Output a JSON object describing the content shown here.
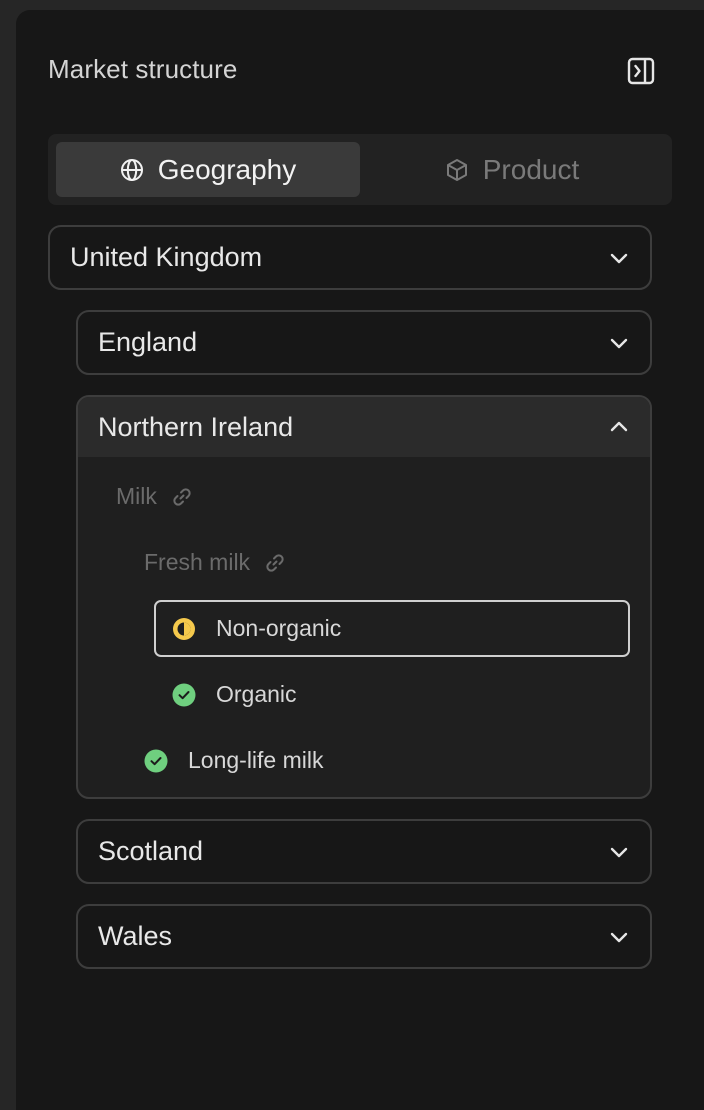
{
  "panel": {
    "title": "Market structure",
    "collapse_icon": "sidebar-collapse-icon"
  },
  "tabs": [
    {
      "label": "Geography",
      "icon": "globe-icon",
      "active": true
    },
    {
      "label": "Product",
      "icon": "cube-icon",
      "active": false
    }
  ],
  "tree": {
    "root": {
      "label": "United Kingdom",
      "expanded": false
    },
    "regions": [
      {
        "label": "England",
        "expanded": false
      },
      {
        "label": "Northern Ireland",
        "expanded": true,
        "items": {
          "milk": {
            "label": "Milk",
            "icon": "link-icon"
          },
          "fresh_milk": {
            "label": "Fresh milk",
            "icon": "link-icon"
          },
          "non_organic": {
            "label": "Non-organic",
            "status": "in-progress",
            "status_color": "#f5c94c",
            "selected": true
          },
          "organic": {
            "label": "Organic",
            "status": "complete",
            "status_color": "#6fcf7f"
          },
          "long_life": {
            "label": "Long-life milk",
            "status": "complete",
            "status_color": "#6fcf7f"
          }
        }
      },
      {
        "label": "Scotland",
        "expanded": false
      },
      {
        "label": "Wales",
        "expanded": false
      }
    ]
  },
  "colors": {
    "panel_bg": "#171717",
    "accent_yellow": "#f5c94c",
    "accent_green": "#6fcf7f"
  }
}
